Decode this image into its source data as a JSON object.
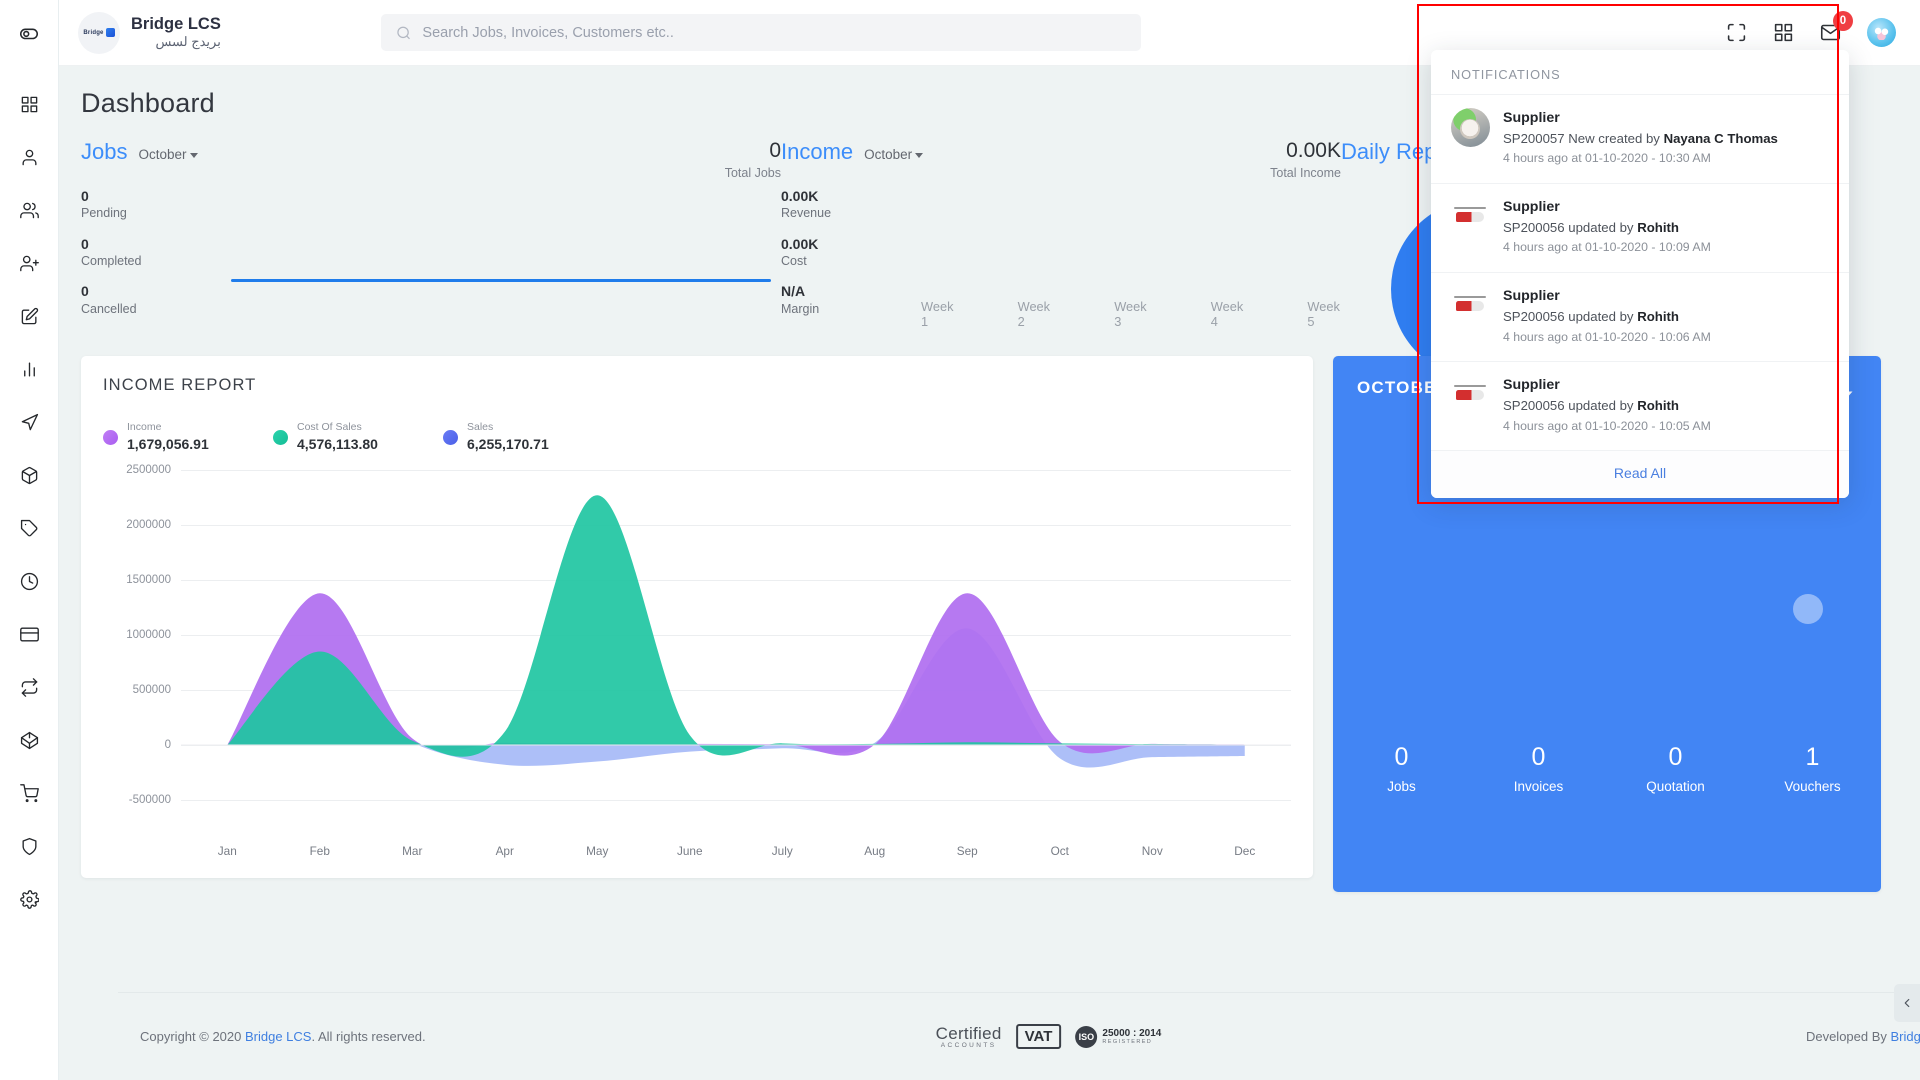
{
  "sidebar": {
    "toggle_icon": "eye-toggle-icon",
    "items": [
      {
        "icon": "grid-dashboard-icon",
        "name": "dashboard"
      },
      {
        "icon": "user-icon",
        "name": "customers"
      },
      {
        "icon": "users-icon",
        "name": "employees"
      },
      {
        "icon": "user-plus-icon",
        "name": "add-user"
      },
      {
        "icon": "edit-square-icon",
        "name": "jobs"
      },
      {
        "icon": "bar-chart-icon",
        "name": "reports"
      },
      {
        "icon": "navigation-icon",
        "name": "air-freight"
      },
      {
        "icon": "package-icon",
        "name": "packages"
      },
      {
        "icon": "tag-icon",
        "name": "pricing"
      },
      {
        "icon": "clock-icon",
        "name": "timesheet"
      },
      {
        "icon": "credit-card-icon",
        "name": "payments"
      },
      {
        "icon": "repeat-icon",
        "name": "transactions"
      },
      {
        "icon": "cube-icon",
        "name": "inventory"
      },
      {
        "icon": "shopping-cart-icon",
        "name": "purchase"
      },
      {
        "icon": "shield-icon",
        "name": "security"
      },
      {
        "icon": "settings-gear-icon",
        "name": "settings"
      }
    ]
  },
  "header": {
    "brand_name": "Bridge LCS",
    "brand_sub": "بريدج لسس",
    "brand_logo_text": "Bridge",
    "search": {
      "placeholder": "Search Jobs, Invoices, Customers etc..",
      "value": ""
    },
    "icons": [
      {
        "name": "fullscreen-icon"
      },
      {
        "name": "apps-grid-icon"
      },
      {
        "name": "mail-icon",
        "badge": "0"
      }
    ],
    "badge_color": "#ef3e42",
    "avatar_name": "user-avatar"
  },
  "page": {
    "title": "Dashboard"
  },
  "jobs_panel": {
    "title": "Jobs",
    "month": "October",
    "total_value": "0",
    "total_label": "Total Jobs",
    "stats": [
      {
        "value": "0",
        "label": "Pending"
      },
      {
        "value": "0",
        "label": "Completed"
      },
      {
        "value": "0",
        "label": "Cancelled"
      }
    ]
  },
  "income_panel": {
    "title": "Income",
    "month": "October",
    "total_value": "0.00K",
    "total_label": "Total Income",
    "stats": [
      {
        "value": "0.00K",
        "label": "Revenue"
      },
      {
        "value": "0.00K",
        "label": "Cost"
      },
      {
        "value": "N/A",
        "label": "Margin"
      }
    ],
    "weeks": [
      "Week 1",
      "Week 2",
      "Week 3",
      "Week 4",
      "Week 5"
    ]
  },
  "daily_panel": {
    "title": "Daily Report"
  },
  "income_report": {
    "card_title": "INCOME REPORT",
    "legend": [
      {
        "label": "Income",
        "value": "1,679,056.91",
        "color": "#b06ef0"
      },
      {
        "label": "Cost Of Sales",
        "value": "4,576,113.80",
        "color": "#20c5a2"
      },
      {
        "label": "Sales",
        "value": "6,255,170.71",
        "color": "#5a6ef0"
      }
    ]
  },
  "chart_data": {
    "type": "area",
    "title": "INCOME REPORT",
    "xlabel": "",
    "ylabel": "",
    "categories": [
      "Jan",
      "Feb",
      "Mar",
      "Apr",
      "May",
      "June",
      "July",
      "Aug",
      "Sep",
      "Oct",
      "Nov",
      "Dec"
    ],
    "ylim": [
      -500000,
      2500000
    ],
    "yticks": [
      2500000,
      2000000,
      1500000,
      1000000,
      500000,
      0,
      -500000
    ],
    "ytick_labels": [
      "2500000",
      "2000000",
      "1500000",
      "1000000",
      "500000",
      "0",
      "-500000"
    ],
    "grid": true,
    "legend_position": "top-left",
    "series": [
      {
        "name": "Income",
        "color": "#b06ef0",
        "values": [
          0,
          1380000,
          60000,
          20000,
          15000,
          10000,
          8000,
          5000,
          1380000,
          30000,
          10000,
          5000
        ]
      },
      {
        "name": "Cost Of Sales",
        "color": "#20c5a2",
        "values": [
          0,
          850000,
          40000,
          120000,
          2270000,
          90000,
          15000,
          10000,
          25000,
          15000,
          8000,
          4000
        ]
      },
      {
        "name": "Sales",
        "color": "#8ea6f5",
        "values": [
          0,
          560000,
          20000,
          -180000,
          -150000,
          -60000,
          -30000,
          20000,
          1060000,
          -120000,
          -110000,
          -100000
        ]
      }
    ]
  },
  "month_card": {
    "title": "OCTOBER",
    "stats": [
      {
        "value": "0",
        "label": "Jobs"
      },
      {
        "value": "0",
        "label": "Invoices"
      },
      {
        "value": "0",
        "label": "Quotation"
      },
      {
        "value": "1",
        "label": "Vouchers"
      }
    ],
    "accent_color": "#4285f4"
  },
  "notifications": {
    "header": "NOTIFICATIONS",
    "items": [
      {
        "title": "Supplier",
        "text_prefix": "SP200057 New created by ",
        "actor": "Nayana C Thomas",
        "time": "4 hours ago at 01-10-2020 - 10:30 AM",
        "avatar": "cat-avatar"
      },
      {
        "title": "Supplier",
        "text_prefix": "SP200056 updated by ",
        "actor": "Rohith",
        "time": "4 hours ago at 01-10-2020 - 10:09 AM",
        "avatar": "helicopter-avatar"
      },
      {
        "title": "Supplier",
        "text_prefix": "SP200056 updated by ",
        "actor": "Rohith",
        "time": "4 hours ago at 01-10-2020 - 10:06 AM",
        "avatar": "helicopter-avatar"
      },
      {
        "title": "Supplier",
        "text_prefix": "SP200056 updated by ",
        "actor": "Rohith",
        "time": "4 hours ago at 01-10-2020 - 10:05 AM",
        "avatar": "helicopter-avatar"
      }
    ],
    "read_all": "Read All",
    "highlight_color": "#ff0000"
  },
  "footer": {
    "copyright_pre": "Copyright © 2020 ",
    "copyright_link": "Bridge LCS",
    "copyright_post": ". All rights reserved.",
    "badges": {
      "certified_main": "Certified",
      "certified_sub": "ACCOUNTS",
      "vat": "VAT",
      "iso_mark": "ISO",
      "iso_main": "25000 : 2014",
      "iso_sub": "REGISTERED"
    },
    "developed_pre": "Developed By ",
    "developed_link": "Bridge LCS"
  }
}
